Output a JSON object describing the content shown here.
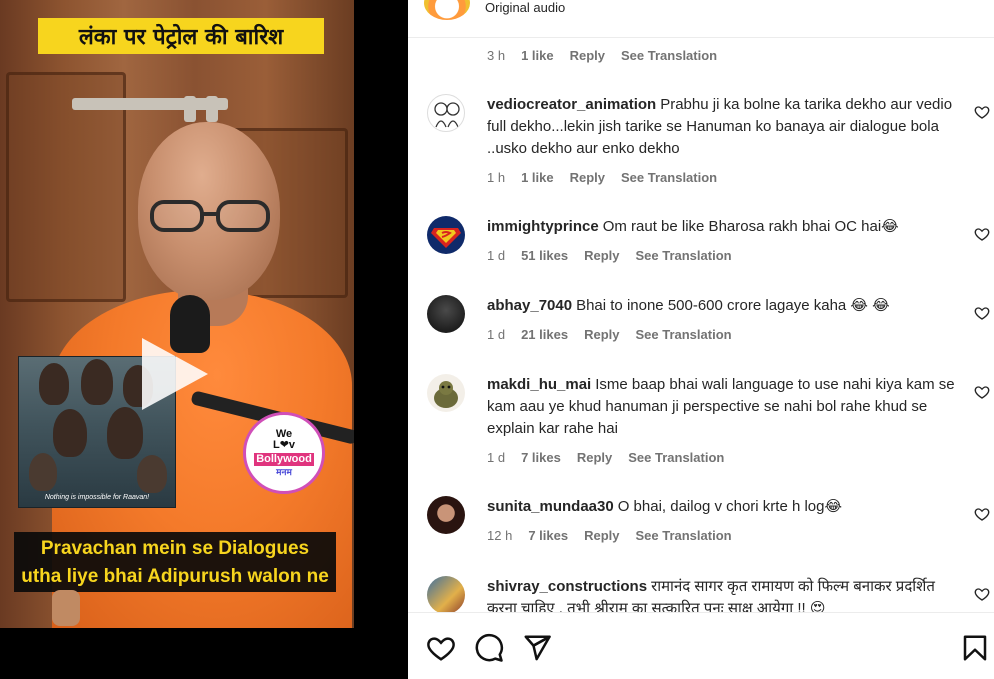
{
  "video": {
    "title_overlay": "लंका पर पेट्रोल की बारिश",
    "subtitle_line1": "Pravachan mein se Dialogues",
    "subtitle_line2": "utha liye bhai Adipurush walon ne",
    "poster_caption": "Nothing is impossible for Raavan!",
    "logo_line1": "We",
    "logo_line2": "L❤v",
    "logo_line3": "Bollywood",
    "logo_line4": "मनम"
  },
  "header": {
    "audio_label": "Original audio"
  },
  "top_meta": {
    "time": "3 h",
    "likes": "1 like",
    "reply": "Reply",
    "see_translation": "See Translation"
  },
  "comments": [
    {
      "user": "vediocreator_animation",
      "text": "Prabhu ji ka bolne ka tarika dekho aur vedio full dekho...lekin jish tarike se Hanuman ko banaya air dialogue bola ..usko dekho aur enko dekho",
      "time": "1 h",
      "likes": "1 like",
      "reply": "Reply",
      "see_translation": "See Translation"
    },
    {
      "user": "immightyprince",
      "text": "Om raut be like Bharosa rakh bhai OC hai😂",
      "time": "1 d",
      "likes": "51 likes",
      "reply": "Reply",
      "see_translation": "See Translation"
    },
    {
      "user": "abhay_7040",
      "text": "Bhai to inone 500-600 crore lagaye kaha 😂 😂",
      "time": "1 d",
      "likes": "21 likes",
      "reply": "Reply",
      "see_translation": "See Translation"
    },
    {
      "user": "makdi_hu_mai",
      "text": "Isme baap bhai wali language to use nahi kiya kam se kam aau ye khud hanuman ji perspective se nahi bol rahe khud se explain kar rahe hai",
      "time": "1 d",
      "likes": "7 likes",
      "reply": "Reply",
      "see_translation": "See Translation"
    },
    {
      "user": "sunita_mundaa30",
      "text": "O bhai, dailog v chori krte h log😂",
      "time": "12 h",
      "likes": "7 likes",
      "reply": "Reply",
      "see_translation": "See Translation"
    },
    {
      "user": "shivray_constructions",
      "text": "रामानंद सागर कृत रामायण को फिल्म बनाकर प्रदर्शित करना चाहिए , तभी श्रीराम का सत्कारित पुनः साक्ष आयेगा !! 😍"
    }
  ],
  "icons": {
    "like": "heart-icon",
    "comment": "comment-icon",
    "share": "send-icon",
    "save": "bookmark-icon"
  },
  "colors": {
    "banner_yellow": "#f7d51e",
    "robe_orange": "#f47a2a",
    "text_primary": "#262626",
    "text_secondary": "#737373"
  }
}
